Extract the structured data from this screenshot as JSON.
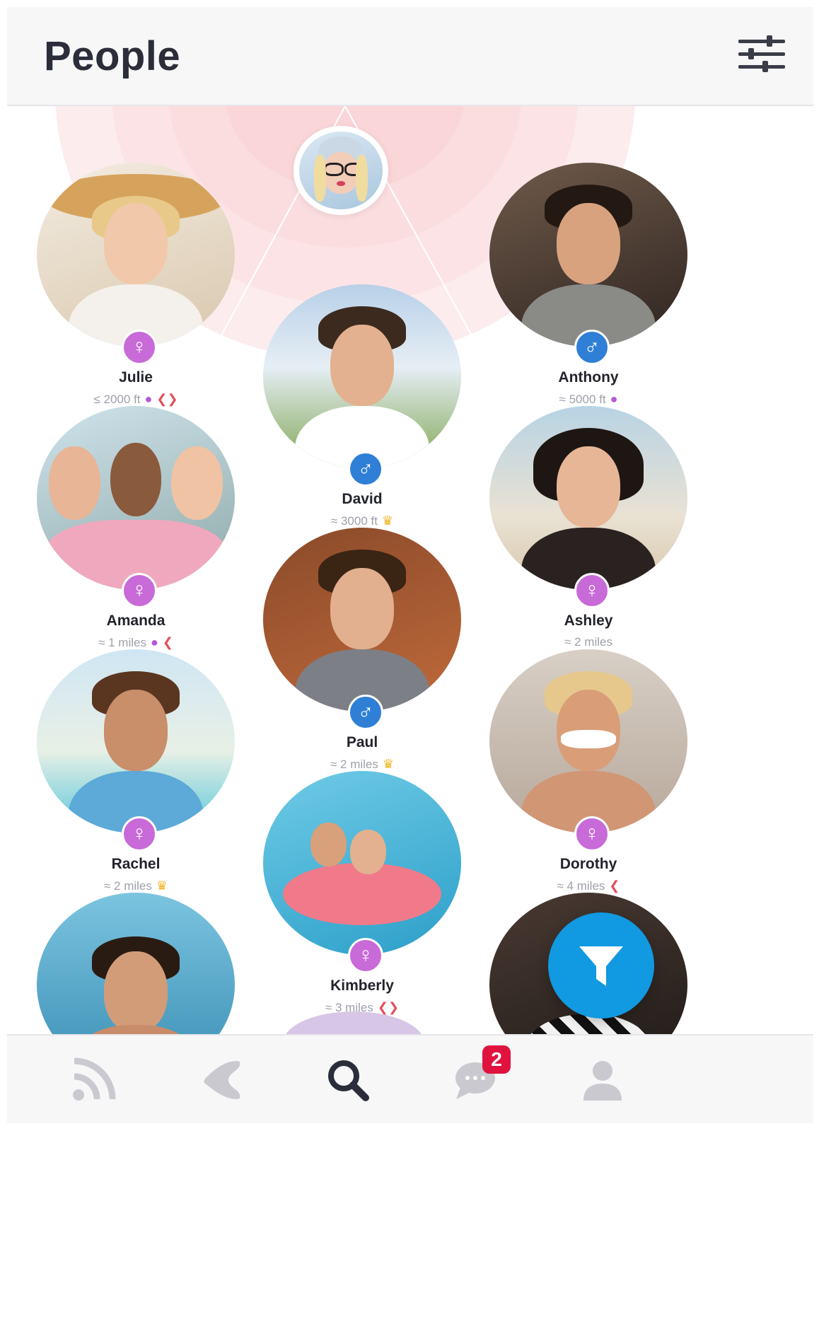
{
  "header": {
    "title": "People"
  },
  "profiles": [
    {
      "name": "Julie",
      "gender": "female",
      "distance": "≤ 2000 ft",
      "badges": [
        "pin",
        "hearts"
      ]
    },
    {
      "name": "David",
      "gender": "male",
      "distance": "≈ 3000 ft",
      "badges": [
        "crown"
      ]
    },
    {
      "name": "Anthony",
      "gender": "male",
      "distance": "≈ 5000 ft",
      "badges": [
        "pin"
      ]
    },
    {
      "name": "Amanda",
      "gender": "female",
      "distance": "≈ 1 miles",
      "badges": [
        "pin",
        "heart"
      ]
    },
    {
      "name": "Paul",
      "gender": "male",
      "distance": "≈ 2 miles",
      "badges": [
        "crown"
      ]
    },
    {
      "name": "Ashley",
      "gender": "female",
      "distance": "≈ 2 miles",
      "badges": []
    },
    {
      "name": "Rachel",
      "gender": "female",
      "distance": "≈ 2 miles",
      "badges": [
        "crown"
      ]
    },
    {
      "name": "Kimberly",
      "gender": "female",
      "distance": "≈ 3 miles",
      "badges": [
        "hearts"
      ]
    },
    {
      "name": "Dorothy",
      "gender": "female",
      "distance": "≈ 4 miles",
      "badges": [
        "heart"
      ]
    }
  ],
  "bottom_nav": {
    "items": [
      "feed-icon",
      "heart-icon",
      "search-icon",
      "chat-icon",
      "profile-icon"
    ],
    "active": "search-icon",
    "messages_badge": "2"
  },
  "colors": {
    "accent": "#1199e1",
    "female": "#c86ad8",
    "male": "#2f7fd6",
    "heart": "#e4505c",
    "crown": "#f2b41f",
    "badge": "#e0133f"
  }
}
